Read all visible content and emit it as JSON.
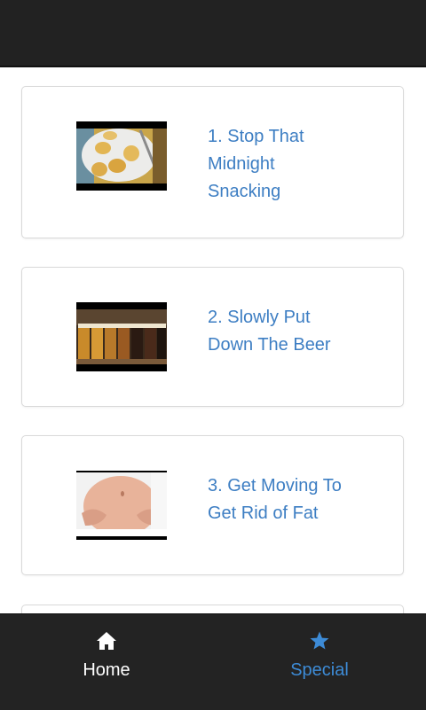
{
  "colors": {
    "top_bar": "#222222",
    "bottom_bar": "#232323",
    "link_blue": "#3d7ec3",
    "nav_active_blue": "#3d8bd6",
    "nav_white": "#ffffff"
  },
  "items": [
    {
      "label": "1. Stop That\nMidnight\nSnacking",
      "image": "midnight-snacks-thumbnail"
    },
    {
      "label": "2. Slowly Put\nDown The Beer",
      "image": "beer-glasses-thumbnail"
    },
    {
      "label": "3. Get Moving To\nGet Rid of Fat",
      "image": "belly-fat-thumbnail"
    }
  ],
  "nav": {
    "home": {
      "label": "Home",
      "icon": "home-icon"
    },
    "special": {
      "label": "Special",
      "icon": "star-icon"
    }
  }
}
